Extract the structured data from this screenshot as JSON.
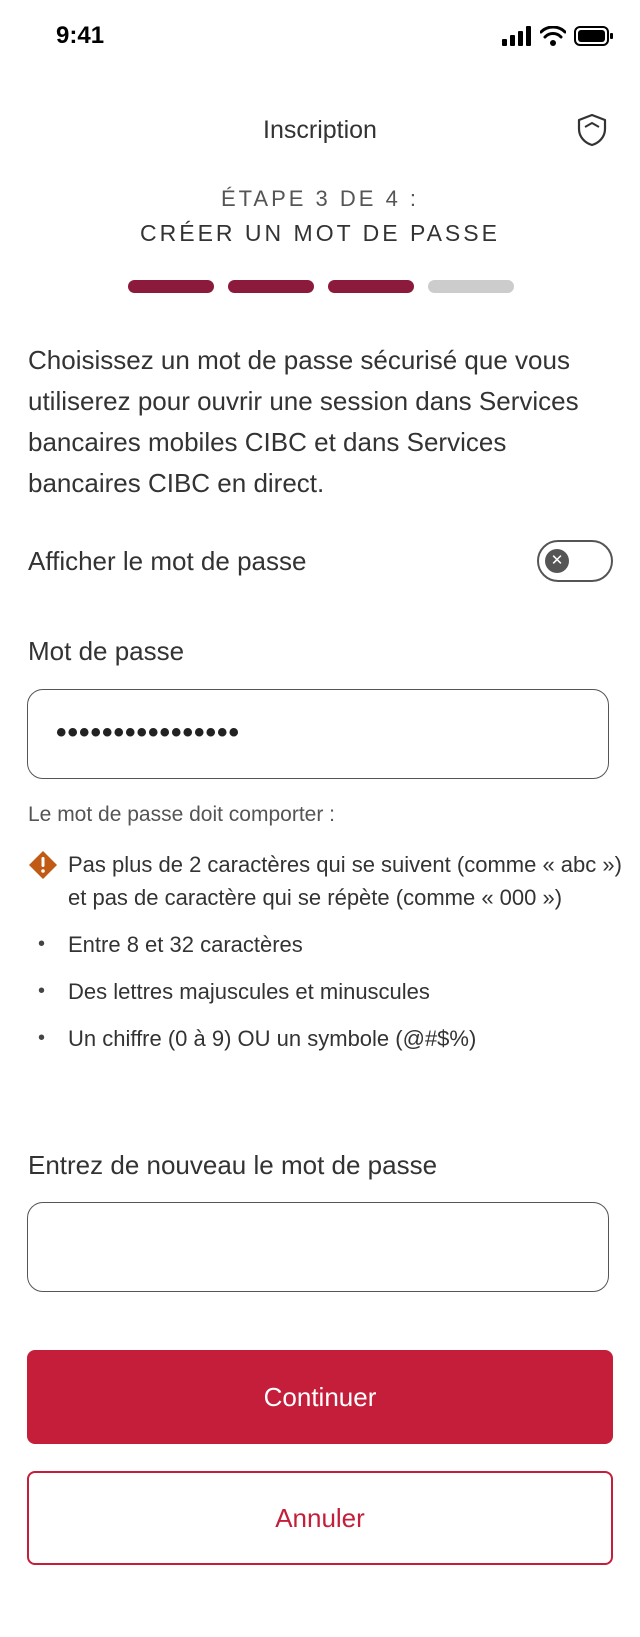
{
  "status_bar": {
    "time": "9:41",
    "icons": [
      "signal-icon",
      "wifi-icon",
      "battery-icon"
    ]
  },
  "header": {
    "title": "Inscription",
    "shield_icon": "shield-icon"
  },
  "step": {
    "label": "ÉTAPE 3 DE 4 :",
    "title": "CRÉER UN MOT DE PASSE",
    "current": 3,
    "total": 4
  },
  "intro": "Choisissez un mot de passe sécurisé que vous utiliserez pour ouvrir une session dans Services bancaires mobiles CIBC et dans Services bancaires CIBC en direct.",
  "toggle": {
    "label": "Afficher le mot de passe",
    "state": "off"
  },
  "password": {
    "label": "Mot de passe",
    "value": "••••••••••••••••"
  },
  "rules": {
    "title": "Le mot de passe doit comporter :",
    "items": [
      {
        "text": "Pas plus de 2 caractères qui se suivent (comme « abc ») et pas de caractère qui se répète (comme « 000 »)",
        "status": "warning"
      },
      {
        "text": "Entre 8 et 32 caractères",
        "status": "bullet"
      },
      {
        "text": "Des lettres majuscules et minuscules",
        "status": "bullet"
      },
      {
        "text": "Un chiffre (0 à 9) OU un symbole (@#$%)",
        "status": "bullet"
      }
    ]
  },
  "confirm": {
    "label": "Entrez de nouveau le mot de passe",
    "value": ""
  },
  "buttons": {
    "continue": "Continuer",
    "cancel": "Annuler"
  },
  "colors": {
    "primary": "#c41e3a",
    "progress_active": "#8b1a3c",
    "progress_inactive": "#cccccc",
    "warning": "#c05a14"
  }
}
